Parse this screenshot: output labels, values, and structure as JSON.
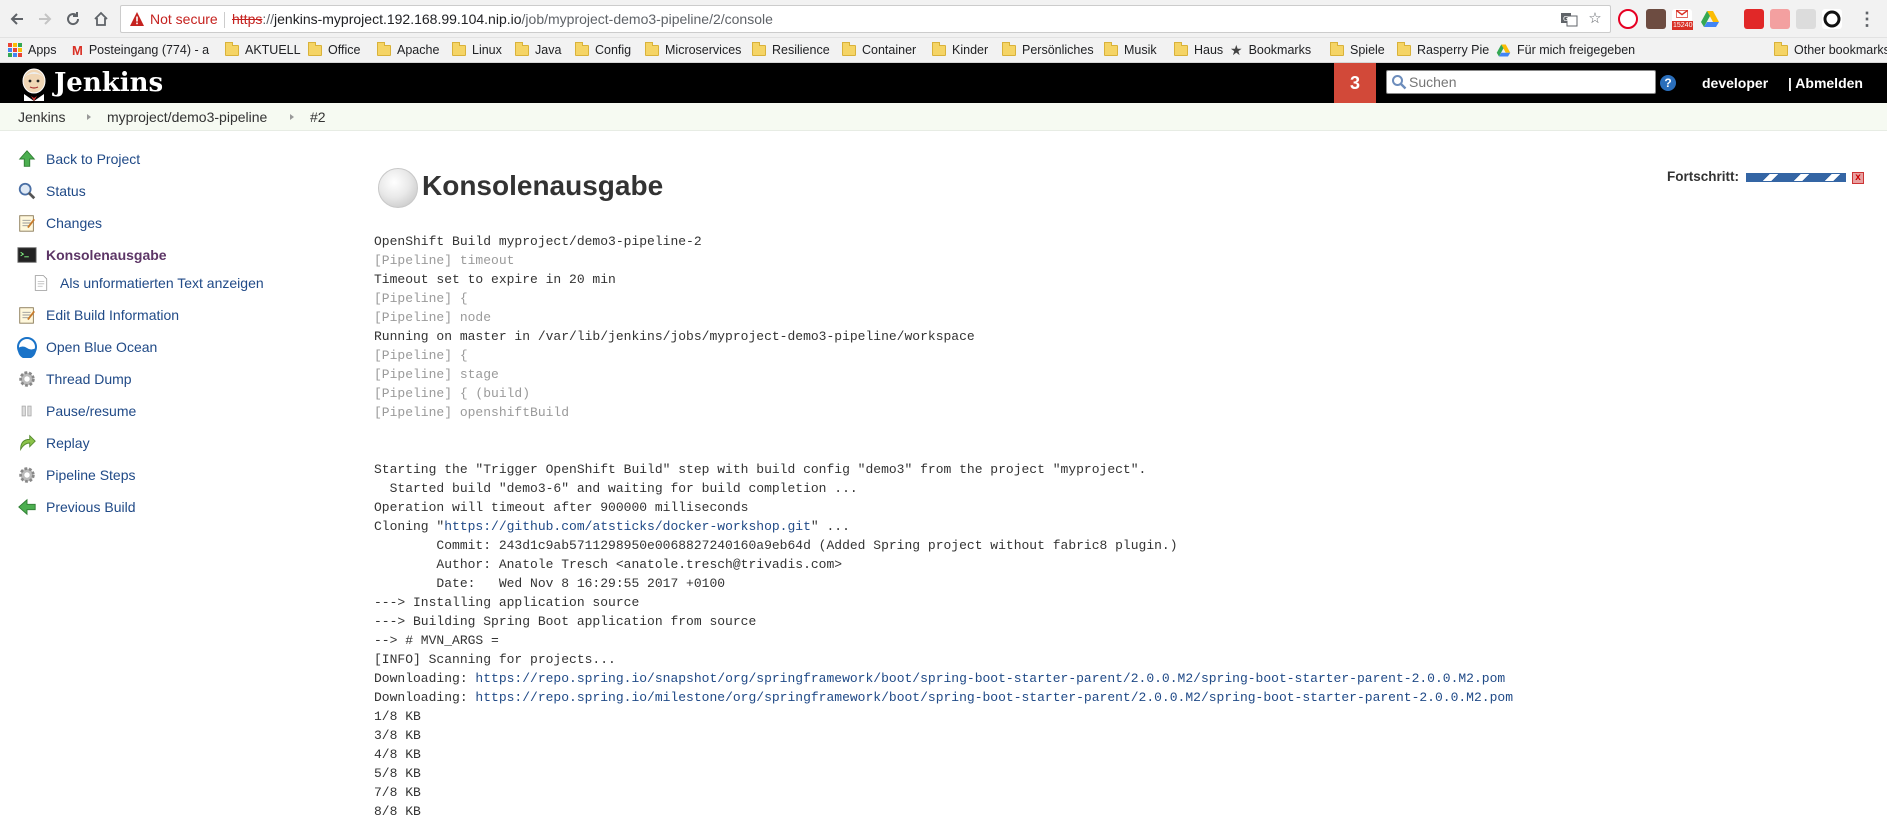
{
  "browser": {
    "security_label": "Not secure",
    "url_scheme": "https",
    "url_sep": "://",
    "url_host": "jenkins-myproject.192.168.99.104.nip.io",
    "url_path": "/job/myproject-demo3-pipeline/2/console",
    "gmail_count": "15240",
    "bookmarks": [
      {
        "label": "Apps",
        "icon": "apps-grid-icon"
      },
      {
        "label": "Posteingang (774) - a",
        "icon": "gmail-icon"
      },
      {
        "label": "AKTUELL",
        "icon": "folder-icon"
      },
      {
        "label": "Office",
        "icon": "folder-icon"
      },
      {
        "label": "Apache",
        "icon": "folder-icon"
      },
      {
        "label": "Linux",
        "icon": "folder-icon"
      },
      {
        "label": "Java",
        "icon": "folder-icon"
      },
      {
        "label": "Config",
        "icon": "folder-icon"
      },
      {
        "label": "Microservices",
        "icon": "folder-icon"
      },
      {
        "label": "Resilience",
        "icon": "folder-icon"
      },
      {
        "label": "Container",
        "icon": "folder-icon"
      },
      {
        "label": "Kinder",
        "icon": "folder-icon"
      },
      {
        "label": "Persönliches",
        "icon": "folder-icon"
      },
      {
        "label": "Musik",
        "icon": "folder-icon"
      },
      {
        "label": "Haus",
        "icon": "folder-icon"
      },
      {
        "label": "Bookmarks",
        "icon": "star-icon"
      },
      {
        "label": "Spiele",
        "icon": "folder-icon"
      },
      {
        "label": "Rasperry Pie",
        "icon": "folder-icon"
      },
      {
        "label": "Für mich freigegeben",
        "icon": "drive-icon"
      },
      {
        "label": "Other bookmarks",
        "icon": "folder-icon"
      }
    ]
  },
  "header": {
    "logo_text": "Jenkins",
    "notification_count": "3",
    "search_placeholder": "Suchen",
    "help_label": "?",
    "user": "developer",
    "logout": "| Abmelden"
  },
  "breadcrumb": [
    "Jenkins",
    "myproject/demo3-pipeline",
    "#2"
  ],
  "sidebar": {
    "items": [
      {
        "label": "Back to Project",
        "icon": "up-arrow-icon"
      },
      {
        "label": "Status",
        "icon": "magnifier-icon"
      },
      {
        "label": "Changes",
        "icon": "notepad-icon"
      },
      {
        "label": "Konsolenausgabe",
        "icon": "terminal-icon",
        "active": true
      },
      {
        "label": "Als unformatierten Text anzeigen",
        "icon": "document-icon",
        "sub": true
      },
      {
        "label": "Edit Build Information",
        "icon": "notepad-edit-icon"
      },
      {
        "label": "Open Blue Ocean",
        "icon": "blue-ocean-icon"
      },
      {
        "label": "Thread Dump",
        "icon": "gear-icon"
      },
      {
        "label": "Pause/resume",
        "icon": "pause-icon"
      },
      {
        "label": "Replay",
        "icon": "replay-arrow-icon"
      },
      {
        "label": "Pipeline Steps",
        "icon": "gear-icon"
      },
      {
        "label": "Previous Build",
        "icon": "left-arrow-icon"
      }
    ]
  },
  "main": {
    "title": "Konsolenausgabe",
    "progress_label": "Fortschritt:",
    "progress_fraction": 1.0,
    "stop_label": "x",
    "console_lines": [
      {
        "text": "OpenShift Build myproject/demo3-pipeline-2",
        "kind": "out"
      },
      {
        "text": "[Pipeline] timeout",
        "kind": "pipeline"
      },
      {
        "text": "Timeout set to expire in 20 min",
        "kind": "out"
      },
      {
        "text": "[Pipeline] {",
        "kind": "pipeline"
      },
      {
        "text": "[Pipeline] node",
        "kind": "pipeline"
      },
      {
        "text": "Running on master in /var/lib/jenkins/jobs/myproject-demo3-pipeline/workspace",
        "kind": "out"
      },
      {
        "text": "[Pipeline] {",
        "kind": "pipeline"
      },
      {
        "text": "[Pipeline] stage",
        "kind": "pipeline"
      },
      {
        "text": "[Pipeline] { (build)",
        "kind": "pipeline"
      },
      {
        "text": "[Pipeline] openshiftBuild",
        "kind": "pipeline"
      },
      {
        "text": "",
        "kind": "blank"
      },
      {
        "text": "",
        "kind": "blank"
      },
      {
        "text": "Starting the \"Trigger OpenShift Build\" step with build config \"demo3\" from the project \"myproject\".",
        "kind": "out"
      },
      {
        "text": "  Started build \"demo3-6\" and waiting for build completion ...",
        "kind": "out"
      },
      {
        "text": "Operation will timeout after 900000 milliseconds",
        "kind": "out"
      },
      {
        "text": "Cloning \"",
        "link": "https://github.com/atsticks/docker-workshop.git",
        "after": "\" ...",
        "kind": "link"
      },
      {
        "text": "        Commit: 243d1c9ab5711298950e0068827240160a9eb64d (Added Spring project without fabric8 plugin.)",
        "kind": "out"
      },
      {
        "text": "        Author: Anatole Tresch <anatole.tresch@trivadis.com>",
        "kind": "out"
      },
      {
        "text": "        Date:   Wed Nov 8 16:29:55 2017 +0100",
        "kind": "out"
      },
      {
        "text": "---> Installing application source",
        "kind": "out"
      },
      {
        "text": "---> Building Spring Boot application from source",
        "kind": "out"
      },
      {
        "text": "--> # MVN_ARGS =",
        "kind": "out"
      },
      {
        "text": "[INFO] Scanning for projects...",
        "kind": "out"
      },
      {
        "text": "Downloading: ",
        "link": "https://repo.spring.io/snapshot/org/springframework/boot/spring-boot-starter-parent/2.0.0.M2/spring-boot-starter-parent-2.0.0.M2.pom",
        "after": "",
        "kind": "link"
      },
      {
        "text": "Downloading: ",
        "link": "https://repo.spring.io/milestone/org/springframework/boot/spring-boot-starter-parent/2.0.0.M2/spring-boot-starter-parent-2.0.0.M2.pom",
        "after": "",
        "kind": "link"
      },
      {
        "text": "1/8 KB",
        "kind": "out"
      },
      {
        "text": "3/8 KB",
        "kind": "out"
      },
      {
        "text": "4/8 KB",
        "kind": "out"
      },
      {
        "text": "5/8 KB",
        "kind": "out"
      },
      {
        "text": "7/8 KB",
        "kind": "out"
      },
      {
        "text": "8/8 KB",
        "kind": "out"
      }
    ]
  }
}
